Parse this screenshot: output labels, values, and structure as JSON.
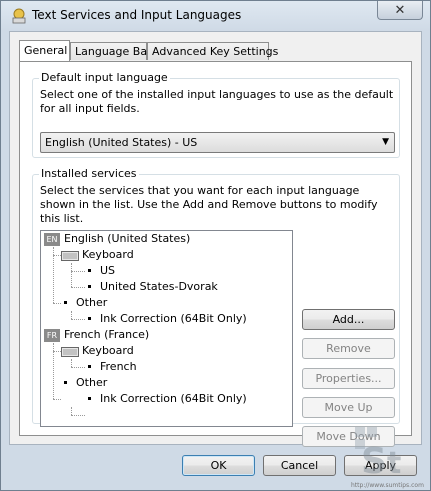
{
  "window": {
    "title": "Text Services and Input Languages",
    "close_glyph": "✕"
  },
  "tabs": [
    {
      "label": "General"
    },
    {
      "label": "Language Bar"
    },
    {
      "label": "Advanced Key Settings"
    }
  ],
  "default_language": {
    "group_title": "Default input language",
    "description": "Select one of the installed input languages to use as the default for all input fields.",
    "selected": "English (United States) - US"
  },
  "installed_services": {
    "group_title": "Installed services",
    "description": "Select the services that you want for each input language shown in the list. Use the Add and Remove buttons to modify this list.",
    "tree": {
      "english": {
        "badge": "EN",
        "label": "English (United States)"
      },
      "en_keyboard": "Keyboard",
      "en_us": "US",
      "en_dvorak": "United States-Dvorak",
      "en_other": "Other",
      "en_ink": "Ink Correction (64Bit Only)",
      "french": {
        "badge": "FR",
        "label": "French (France)"
      },
      "fr_keyboard": "Keyboard",
      "fr_french": "French",
      "fr_other": "Other",
      "fr_ink": "Ink Correction (64Bit Only)"
    },
    "buttons": {
      "add": "Add...",
      "remove": "Remove",
      "properties": "Properties...",
      "move_up": "Move Up",
      "move_down": "Move Down"
    }
  },
  "footer": {
    "ok": "OK",
    "cancel": "Cancel",
    "apply": "Apply"
  },
  "watermark": {
    "logo_text": "St",
    "url": "http://www.sumtips.com"
  },
  "icons": {
    "title": "keyboard-globe-icon",
    "keyboard": "keyboard-icon"
  }
}
